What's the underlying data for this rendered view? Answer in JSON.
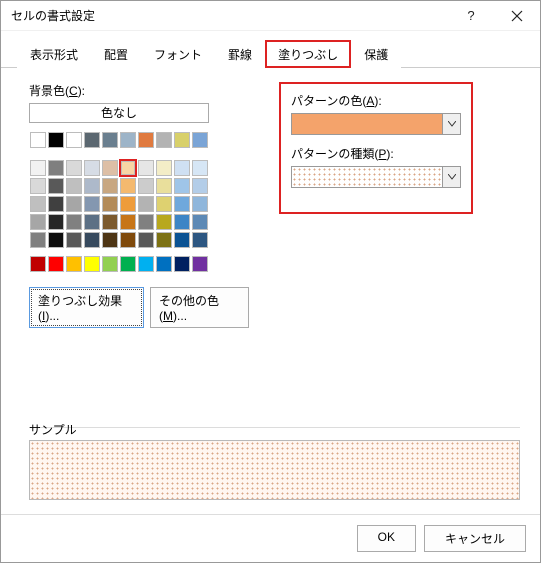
{
  "title": "セルの書式設定",
  "tabs": [
    "表示形式",
    "配置",
    "フォント",
    "罫線",
    "塗りつぶし",
    "保護"
  ],
  "left": {
    "bgcolor_label": "背景色",
    "bgcolor_mn": "C",
    "nocolor": "色なし",
    "fill_effects": "塗りつぶし効果",
    "fill_effects_mn": "I",
    "more_colors": "その他の色",
    "more_colors_mn": "M",
    "palette_theme": [
      "empty",
      "#000000",
      "#ffffff",
      "#5b6770",
      "#6a7f8f",
      "#9db4c8",
      "#e07a3f",
      "#b3b3b3",
      "#d8d06a",
      "#7aa4d6"
    ],
    "palette_tints": [
      [
        "#f2f2f2",
        "#7f7f7f",
        "#d9d9d9",
        "#d6dce5",
        "#ddbfa6",
        "#f8d4a5",
        "#e6e6e6",
        "#f3edc7",
        "#cfe0f3",
        "#d6e6f5"
      ],
      [
        "#d9d9d9",
        "#595959",
        "#bfbfbf",
        "#adb9ca",
        "#c8a781",
        "#f4b96e",
        "#cccccc",
        "#e9df9c",
        "#9fc5e8",
        "#b3cde8"
      ],
      [
        "#bfbfbf",
        "#404040",
        "#a6a6a6",
        "#8497b0",
        "#b38b58",
        "#ee9c3b",
        "#b3b3b3",
        "#ded170",
        "#6fa8dc",
        "#8fb6db"
      ],
      [
        "#a6a6a6",
        "#262626",
        "#808080",
        "#5c7085",
        "#7c5a2d",
        "#c77518",
        "#808080",
        "#b8a81e",
        "#3d85c6",
        "#5d89b5"
      ],
      [
        "#808080",
        "#0d0d0d",
        "#595959",
        "#374a5e",
        "#4e3514",
        "#7f4a0c",
        "#595959",
        "#7d7214",
        "#0b5394",
        "#2d5782"
      ]
    ],
    "selected_tint": [
      0,
      5
    ],
    "palette_standard": [
      "#c00000",
      "#ff0000",
      "#ffc000",
      "#ffff00",
      "#92d050",
      "#00b050",
      "#00b0f0",
      "#0070c0",
      "#002060",
      "#7030a0"
    ]
  },
  "right": {
    "pat_color_label": "パターンの色",
    "pat_color_mn": "A",
    "pat_color_value": "#f4a36b",
    "pat_style_label": "パターンの種類",
    "pat_style_mn": "P",
    "pat_style_value": "dotted-6.25%"
  },
  "sample": {
    "label": "サンプル"
  },
  "footer": {
    "ok": "OK",
    "cancel": "キャンセル"
  }
}
